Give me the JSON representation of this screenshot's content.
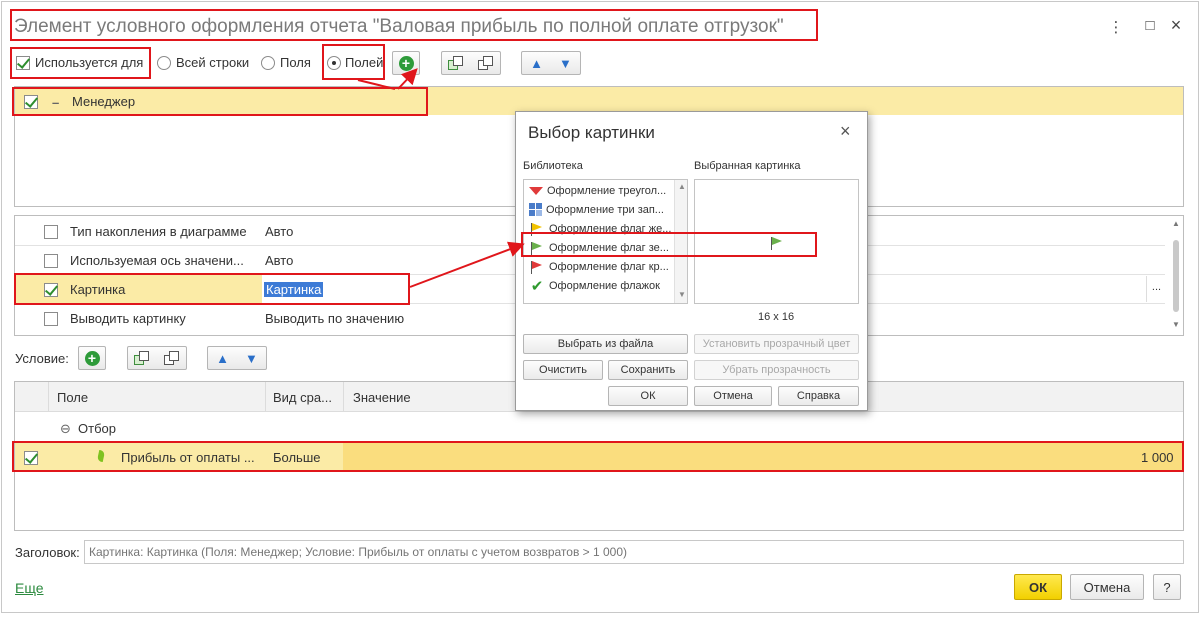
{
  "window": {
    "title": "Элемент условного оформления отчета \"Валовая прибыль по полной оплате отгрузок\"",
    "more_icon": "⋮",
    "maximize_icon": "□",
    "close_icon": "×"
  },
  "toolbar": {
    "used_for_label": "Используется для",
    "radio_all_rows": "Всей строки",
    "radio_field": "Поля",
    "radio_fields": "Полей"
  },
  "fields_list": {
    "items": [
      {
        "label": "Менеджер",
        "checked": true
      }
    ]
  },
  "properties": {
    "rows": [
      {
        "name": "Тип накопления в диаграмме",
        "value": "Авто",
        "checked": false
      },
      {
        "name": "Используемая ось значени...",
        "value": "Авто",
        "checked": false
      },
      {
        "name": "Картинка",
        "value": "Картинка",
        "checked": true
      },
      {
        "name": "Выводить картинку",
        "value": "Выводить по значению",
        "checked": false
      }
    ],
    "ellipsis": "..."
  },
  "condition": {
    "label": "Условие:",
    "columns": [
      "Поле",
      "Вид сра...",
      "Значение"
    ],
    "group_label": "Отбор",
    "row": {
      "field": "Прибыль от оплаты ...",
      "comparison": "Больше",
      "value": "1 000"
    }
  },
  "heading": {
    "label": "Заголовок:",
    "placeholder": "Картинка: Картинка (Поля: Менеджер; Условие: Прибыль от оплаты с учетом возвратов > 1 000)"
  },
  "footer": {
    "more_link": "Еще",
    "ok": "ОК",
    "cancel": "Отмена",
    "help": "?"
  },
  "dialog": {
    "title": "Выбор картинки",
    "close_icon": "×",
    "library_label": "Библиотека",
    "selected_label": "Выбранная картинка",
    "library_items": [
      "Оформление треугол...",
      "Оформление три зап...",
      "Оформление флаг же...",
      "Оформление флаг зе...",
      "Оформление флаг кр...",
      "Оформление флажок"
    ],
    "size_label": "16 x 16",
    "buttons": {
      "choose_file": "Выбрать из файла",
      "set_transparent": "Установить прозрачный цвет",
      "clear": "Очистить",
      "save": "Сохранить",
      "remove_transparency": "Убрать прозрачность",
      "ok": "ОК",
      "cancel": "Отмена",
      "help": "Справка"
    }
  },
  "colors": {
    "highlight_yellow": "#fbeba6",
    "annotation_red": "#e0161b",
    "ok_button_yellow": "#f2d000",
    "selection_blue": "#3d7bd6"
  }
}
